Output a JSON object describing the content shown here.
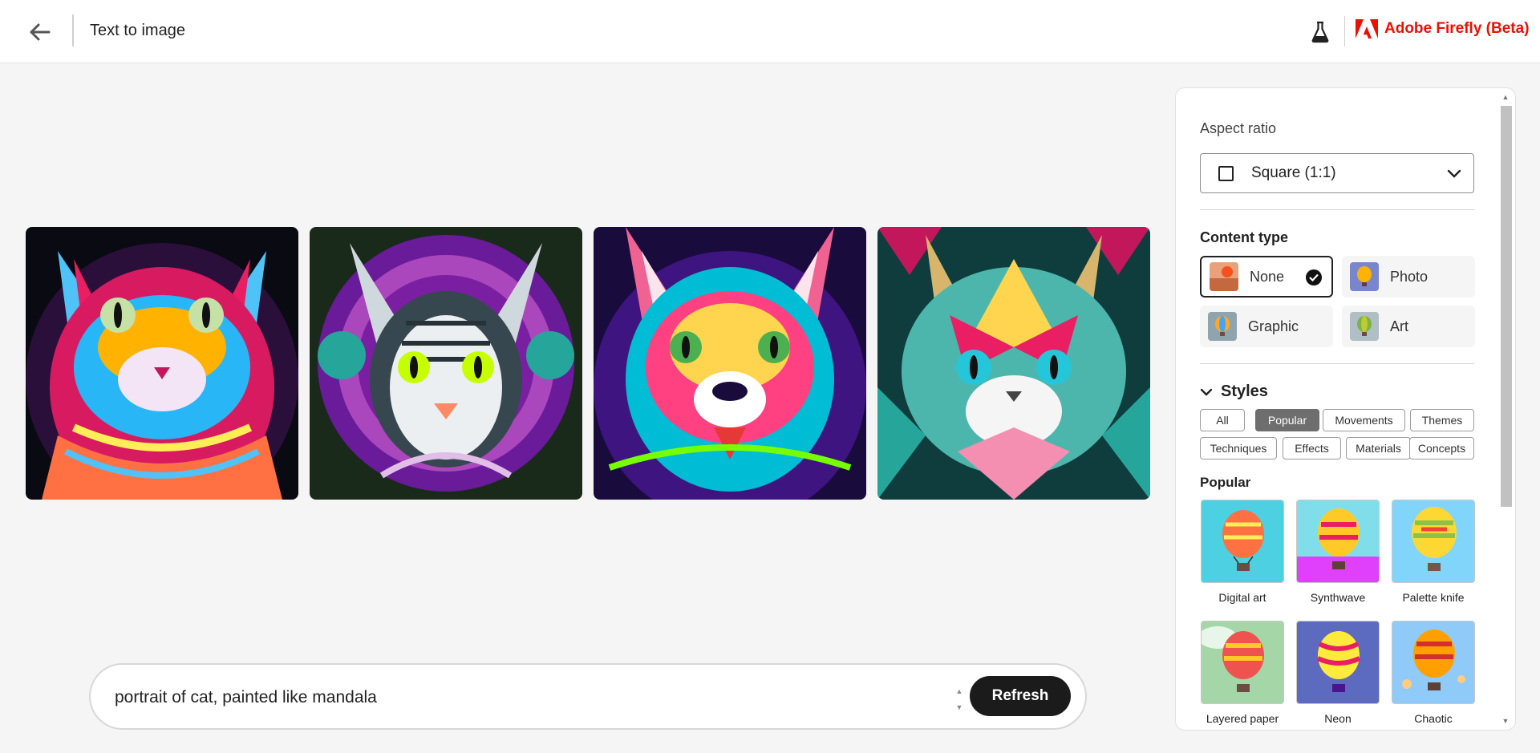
{
  "header": {
    "title": "Text to image",
    "brand": "Adobe Firefly (Beta)"
  },
  "gallery": {
    "images": [
      {
        "alt": "cat mandala 1"
      },
      {
        "alt": "cat mandala 2"
      },
      {
        "alt": "cat mandala 3"
      },
      {
        "alt": "cat mandala 4"
      }
    ]
  },
  "prompt": {
    "value": "portrait of cat, painted like mandala",
    "refresh_label": "Refresh"
  },
  "panel": {
    "aspect_ratio": {
      "label": "Aspect ratio",
      "value": "Square (1:1)"
    },
    "content_type": {
      "label": "Content type",
      "options": [
        {
          "label": "None",
          "selected": true
        },
        {
          "label": "Photo",
          "selected": false
        },
        {
          "label": "Graphic",
          "selected": false
        },
        {
          "label": "Art",
          "selected": false
        }
      ]
    },
    "styles": {
      "label": "Styles",
      "chips": [
        "All",
        "Popular",
        "Movements",
        "Themes",
        "Techniques",
        "Effects",
        "Materials",
        "Concepts"
      ],
      "active_chip": "Popular",
      "section_label": "Popular",
      "tiles": [
        {
          "name": "Digital art"
        },
        {
          "name": "Synthwave"
        },
        {
          "name": "Palette knife"
        },
        {
          "name": "Layered paper"
        },
        {
          "name": "Neon"
        },
        {
          "name": "Chaotic"
        }
      ]
    }
  },
  "colors": {
    "brand_red": "#eb1000",
    "dark_button": "#1b1b1b",
    "active_chip": "#6e6e6e"
  }
}
